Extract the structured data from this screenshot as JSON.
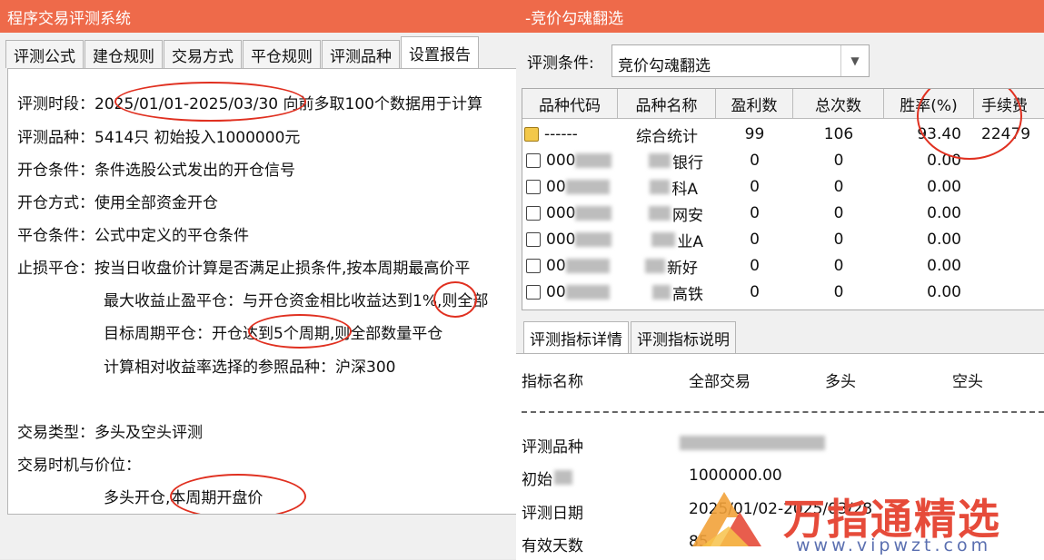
{
  "left_window": {
    "title": "程序交易评测系统",
    "tabs": [
      "评测公式",
      "建仓规则",
      "交易方式",
      "平仓规则",
      "评测品种",
      "设置报告"
    ],
    "lines": {
      "period": "评测时段：2025/01/01-2025/03/30 向前多取100个数据用于计算",
      "variety": "评测品种：5414只 初始投入1000000元",
      "open_cond": "开仓条件：条件选股公式发出的开仓信号",
      "open_mode": "开仓方式：使用全部资金开仓",
      "close_cond": "平仓条件：公式中定义的平仓条件",
      "stop": "止损平仓：按当日收盘价计算是否满足止损条件,按本周期最高价平",
      "max_profit": "最大收益止盈平仓：与开仓资金相比收益达到1%,则全部",
      "target_period": "目标周期平仓：开仓达到5个周期,则全部数量平仓",
      "ref": "计算相对收益率选择的参照品种：沪深300",
      "trade_type": "交易类型：多头及空头评测",
      "timing": "交易时机与价位：",
      "long_open": "多头开仓,本周期开盘价"
    }
  },
  "right_window": {
    "title": "-竞价勾魂翻选",
    "condition_label": "评测条件:",
    "condition_value": "竞价勾魂翻选",
    "columns": [
      "品种代码",
      "品种名称",
      "盈利数",
      "总次数",
      "胜率(%)",
      "手续费"
    ],
    "rows": [
      {
        "code": "------",
        "name": "综合统计",
        "profit": "99",
        "total": "106",
        "rate": "93.40",
        "fee": "22479",
        "summary": true
      },
      {
        "code": "000",
        "name": "银行",
        "profit": "0",
        "total": "0",
        "rate": "0.00",
        "fee": ""
      },
      {
        "code": "00",
        "name": "科A",
        "profit": "0",
        "total": "0",
        "rate": "0.00",
        "fee": ""
      },
      {
        "code": "000",
        "name": "网安",
        "profit": "0",
        "total": "0",
        "rate": "0.00",
        "fee": ""
      },
      {
        "code": "000",
        "name": "业A",
        "profit": "0",
        "total": "0",
        "rate": "0.00",
        "fee": ""
      },
      {
        "code": "00",
        "name": "新好",
        "profit": "0",
        "total": "0",
        "rate": "0.00",
        "fee": ""
      },
      {
        "code": "00",
        "name": "高铁",
        "profit": "0",
        "total": "0",
        "rate": "0.00",
        "fee": ""
      }
    ],
    "bottom_tabs": [
      "评测指标详情",
      "评测指标说明"
    ],
    "detail_header": [
      "指标名称",
      "全部交易",
      "多头",
      "空头"
    ],
    "details": [
      {
        "label": "评测品种",
        "value": ""
      },
      {
        "label": "初始",
        "value": "1000000.00"
      },
      {
        "label": "评测日期",
        "value": "2025/01/02-2025/03/28"
      },
      {
        "label": "有效天数",
        "value": "85"
      }
    ]
  },
  "watermark": {
    "text": "万指通精选",
    "url": "www.vipwzt.com",
    "color": "#e64b3a"
  },
  "colors": {
    "title_bar": "#ee6a4a",
    "annotation": "#e03020"
  }
}
